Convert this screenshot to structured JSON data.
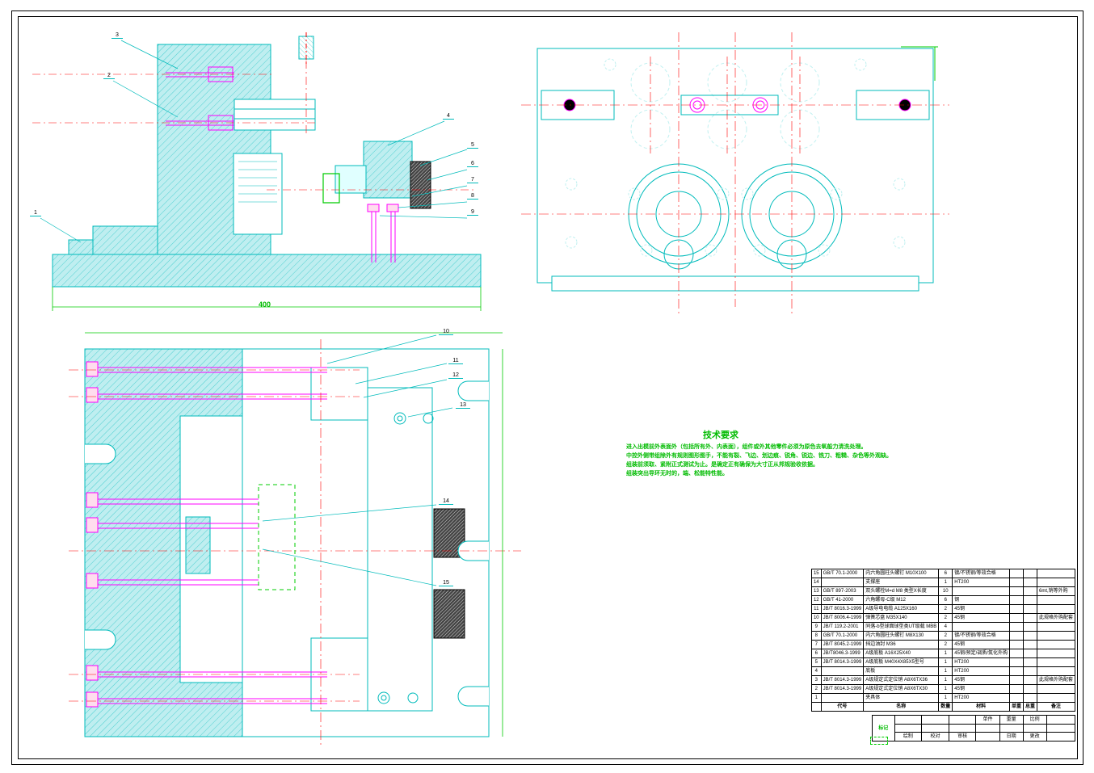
{
  "balloons": [
    "1",
    "2",
    "3",
    "4",
    "5",
    "6",
    "7",
    "8",
    "9",
    "10",
    "11",
    "12",
    "13",
    "14",
    "15"
  ],
  "dims": {
    "front_w": "400",
    "top_h": ""
  },
  "notes": {
    "title": "技术要求",
    "l1": "进入出模前外表面外（包括所有外、内表面），组件或外其他零件必须为原色去氧般力清洗处理。",
    "l2": "中控外侧带组除外有规则图形图手，不能有裂、飞边、划边痕、锐角、锐边、铣刀、粗糙、杂色等外观缺。",
    "l3": "组装前须取、紧附正式测试为止。是确定正有确保为大寸正从邦规验收依据。",
    "l4": "组装突出导环无时的，端、松能特性能。"
  },
  "bom": {
    "header": [
      "",
      "代号",
      "名称",
      "数量",
      "材料",
      "单重",
      "总重",
      "备注"
    ],
    "rows": [
      {
        "n": "15",
        "code": "GB/T 70.1-2000",
        "name": "内六角圆柱头螺钉 M10X100",
        "qty": "6",
        "mat": "镀/不锈钢/等效合格",
        "note": ""
      },
      {
        "n": "14",
        "code": "",
        "name": "支撑座",
        "qty": "1",
        "mat": "HT200",
        "note": ""
      },
      {
        "n": "13",
        "code": "GB/T 897-2003",
        "name": "双头螺栓M=d M8 类型X长度",
        "qty": "10",
        "mat": "",
        "note": "6mt,销等外购"
      },
      {
        "n": "12",
        "code": "GB/T 41-2000",
        "name": "六角螺母-C级 M12",
        "qty": "6",
        "mat": "钢",
        "note": ""
      },
      {
        "n": "11",
        "code": "JB/T 8016.3-1999",
        "name": "A级导电电缆 A125X160",
        "qty": "2",
        "mat": "45钢",
        "note": ""
      },
      {
        "n": "10",
        "code": "JB/T 8006.4-1999",
        "name": "弹簧芯盘 M35X140",
        "qty": "2",
        "mat": "45钢",
        "note": "此规格外购配套"
      },
      {
        "n": "9",
        "code": "JB/T 119.2-2001",
        "name": "同落-b型球面球型类UT级载 MBB",
        "qty": "4",
        "mat": "",
        "note": ""
      },
      {
        "n": "8",
        "code": "GB/T 70.1-2000",
        "name": "内六角圆柱头螺钉 M8X130",
        "qty": "2",
        "mat": "镀/不锈钢/等效合格",
        "note": ""
      },
      {
        "n": "7",
        "code": "JB/T 8045.2-1999",
        "name": "挡边油封 M36",
        "qty": "2",
        "mat": "45钢",
        "note": ""
      },
      {
        "n": "6",
        "code": "JB/T8046.3-1999",
        "name": "A级底板 A16X25X40",
        "qty": "1",
        "mat": "45钢/预定/调质/氮化外购",
        "note": ""
      },
      {
        "n": "5",
        "code": "JB/T 8014.3-1999",
        "name": "A级底板 M40X4X85X5型号",
        "qty": "1",
        "mat": "HT200",
        "note": ""
      },
      {
        "n": "4",
        "code": "",
        "name": "底板",
        "qty": "1",
        "mat": "HT200",
        "note": ""
      },
      {
        "n": "3",
        "code": "JB/T 8014.3-1999",
        "name": "A级规定式定位销 A8X6TX36",
        "qty": "1",
        "mat": "45钢",
        "note": "此规格外购配套"
      },
      {
        "n": "2",
        "code": "JB/T 8014.3-1999",
        "name": "A级规定式定位销 A8X6TX30",
        "qty": "1",
        "mat": "45钢",
        "note": ""
      },
      {
        "n": "1",
        "code": "",
        "name": "夹具体",
        "qty": "1",
        "mat": "HT200",
        "note": ""
      }
    ]
  },
  "tb": {
    "unit": "单件",
    "wt": "重量",
    "scale": "比例",
    "approved": "审核",
    "drawn": "绘制",
    "check": "校对",
    "date": "日期",
    "rev": "更改",
    "mark": "标记"
  }
}
